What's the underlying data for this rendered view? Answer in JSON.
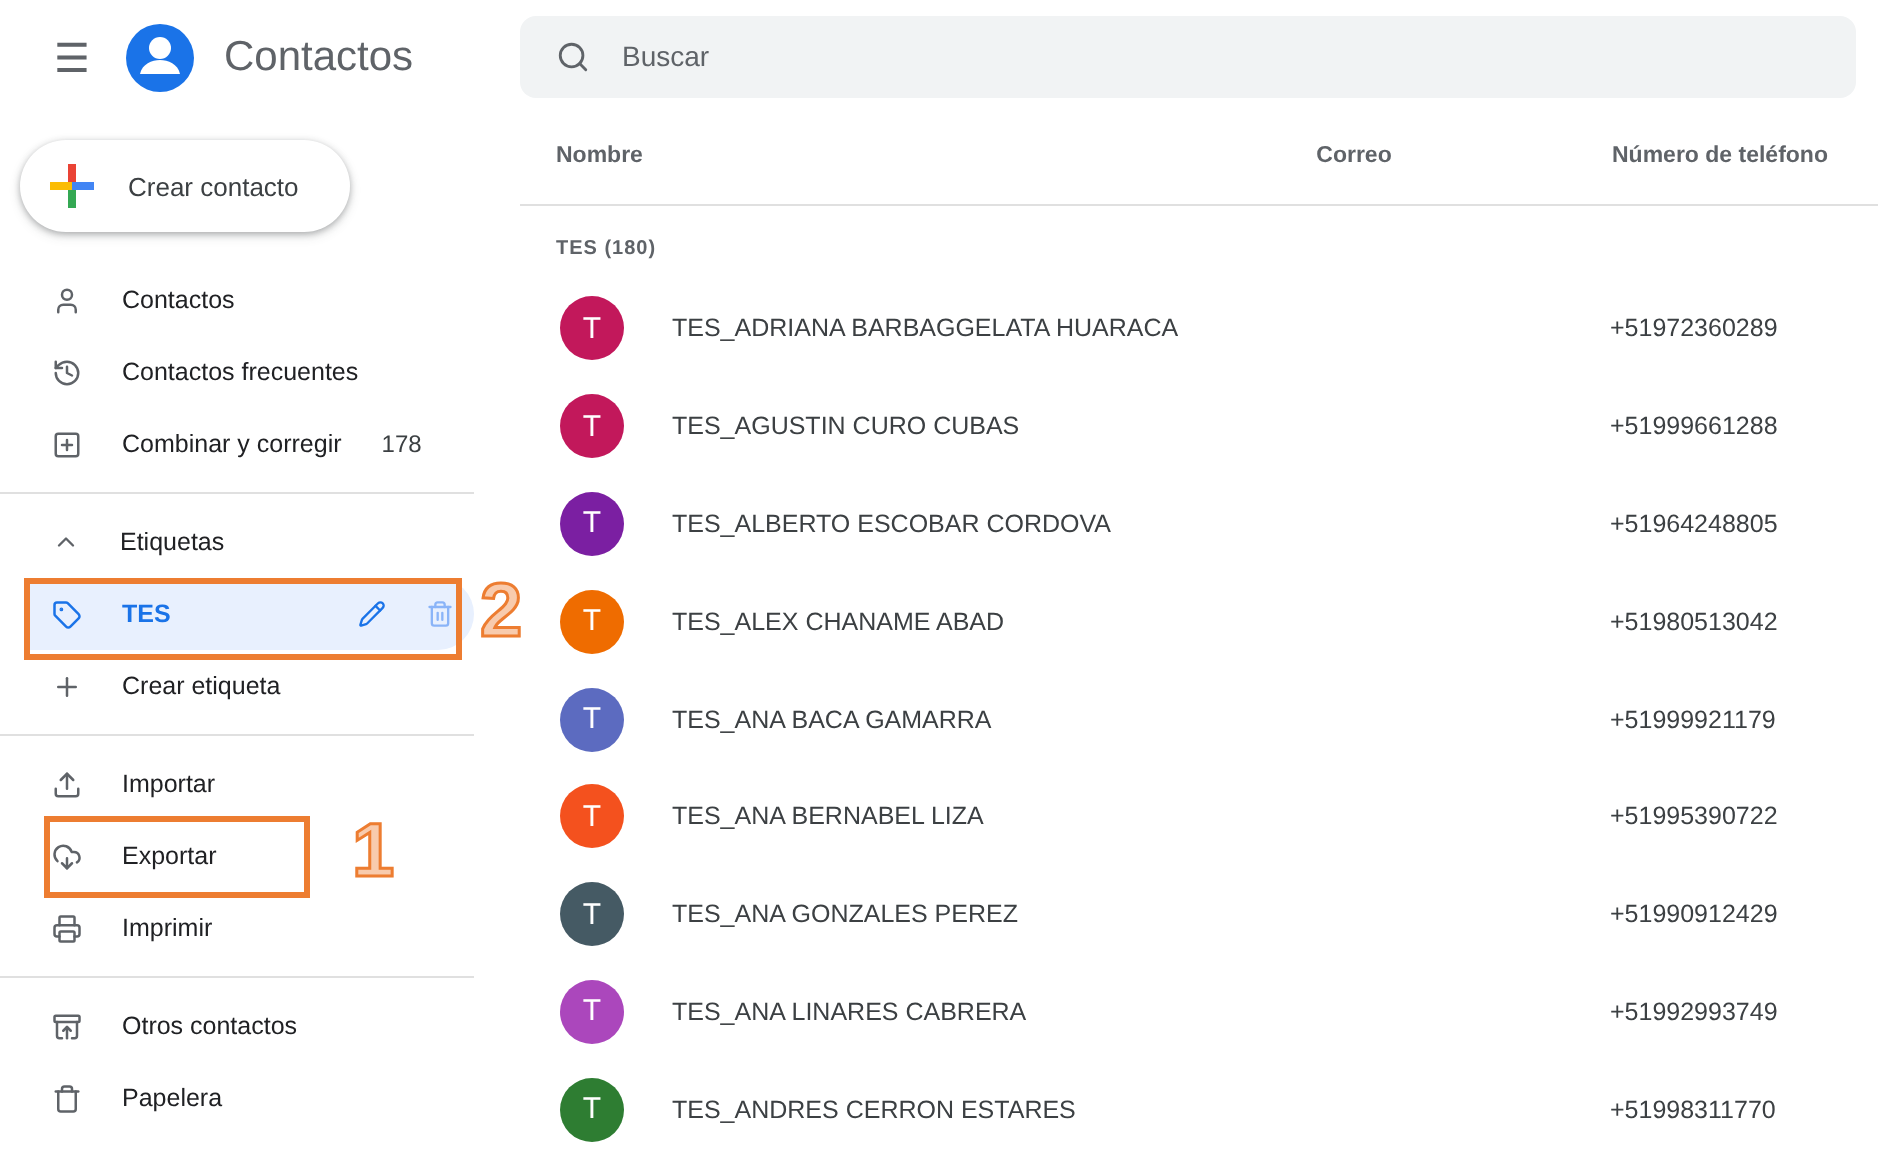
{
  "header": {
    "menu_icon": "☰",
    "title": "Contactos",
    "search": {
      "placeholder": "Buscar"
    }
  },
  "create_button": {
    "label": "Crear contacto"
  },
  "sidebar": {
    "groups": [
      {
        "items": [
          {
            "kind": "contacts",
            "label": "Contactos",
            "selected": false
          },
          {
            "kind": "history",
            "label": "Contactos frecuentes",
            "selected": false
          },
          {
            "kind": "merge",
            "label": "Combinar y corregir",
            "count": "178",
            "selected": false
          }
        ]
      },
      {
        "heading": {
          "label": "Etiquetas",
          "expanded": true
        },
        "items": [
          {
            "kind": "label",
            "label": "TES",
            "selected": true,
            "actions": true,
            "annotation": "2"
          },
          {
            "kind": "add",
            "label": "Crear etiqueta",
            "selected": false
          }
        ]
      },
      {
        "items": [
          {
            "kind": "import",
            "label": "Importar",
            "selected": false
          },
          {
            "kind": "export",
            "label": "Exportar",
            "selected": false,
            "annotation": "1"
          },
          {
            "kind": "print",
            "label": "Imprimir",
            "selected": false
          }
        ]
      },
      {
        "items": [
          {
            "kind": "other",
            "label": "Otros contactos",
            "selected": false
          },
          {
            "kind": "trash",
            "label": "Papelera",
            "selected": false
          }
        ]
      }
    ]
  },
  "table": {
    "columns": [
      "Nombre",
      "Correo",
      "Número de teléfono"
    ],
    "group_label": "TES (180)",
    "rows": [
      {
        "initial": "T",
        "color": "#c2185b",
        "name": "TES_ADRIANA BARBAGGELATA HUARACA",
        "phone": "+51972360289"
      },
      {
        "initial": "T",
        "color": "#c2185b",
        "name": "TES_AGUSTIN CURO CUBAS",
        "phone": "+51999661288"
      },
      {
        "initial": "T",
        "color": "#7b1fa2",
        "name": "TES_ALBERTO ESCOBAR CORDOVA",
        "phone": "+51964248805"
      },
      {
        "initial": "T",
        "color": "#ef6c00",
        "name": "TES_ALEX CHANAME ABAD",
        "phone": "+51980513042"
      },
      {
        "initial": "T",
        "color": "#5c6bc0",
        "name": "TES_ANA BACA GAMARRA",
        "phone": "+51999921179"
      },
      {
        "initial": "T",
        "color": "#f4511e",
        "name": "TES_ANA BERNABEL LIZA",
        "phone": "+51995390722"
      },
      {
        "initial": "T",
        "color": "#455a64",
        "name": "TES_ANA GONZALES PEREZ",
        "phone": "+51990912429"
      },
      {
        "initial": "T",
        "color": "#ab47bc",
        "name": "TES_ANA LINARES CABRERA",
        "phone": "+51992993749"
      },
      {
        "initial": "T",
        "color": "#2e7d32",
        "name": "TES_ANDRES CERRON ESTARES",
        "phone": "+51998311770"
      }
    ]
  }
}
